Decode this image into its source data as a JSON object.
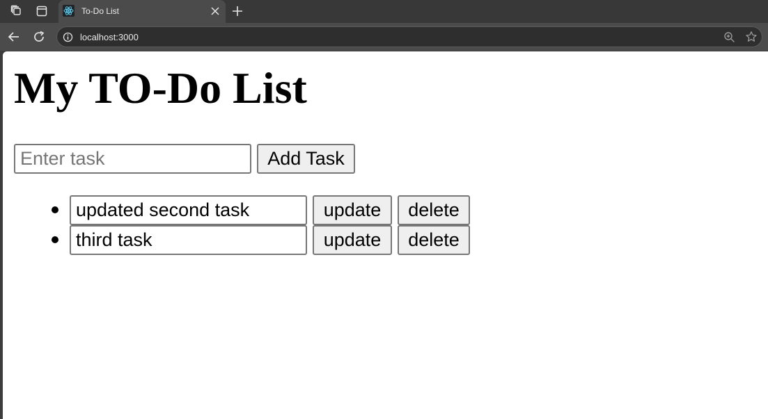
{
  "browser": {
    "tab_title": "To-Do List",
    "url": "localhost:3000",
    "icons": {
      "workspaces": "workspaces-icon",
      "sidebar": "sidebar-icon",
      "favicon": "react-icon",
      "close": "close-icon",
      "new_tab": "plus-icon",
      "back": "back-arrow-icon",
      "reload": "reload-icon",
      "info": "info-icon",
      "zoom": "zoom-icon",
      "bookmark": "star-icon"
    },
    "colors": {
      "tabbar": "#383838",
      "toolbar": "#4b4b4b",
      "omnibox": "#2e2e2e"
    }
  },
  "page": {
    "title": "My TO-Do List",
    "new_task": {
      "value": "",
      "placeholder": "Enter task"
    },
    "add_button": "Add Task",
    "tasks": [
      {
        "text": "updated second task",
        "update_label": "update",
        "delete_label": "delete"
      },
      {
        "text": "third task",
        "update_label": "update",
        "delete_label": "delete"
      }
    ]
  }
}
